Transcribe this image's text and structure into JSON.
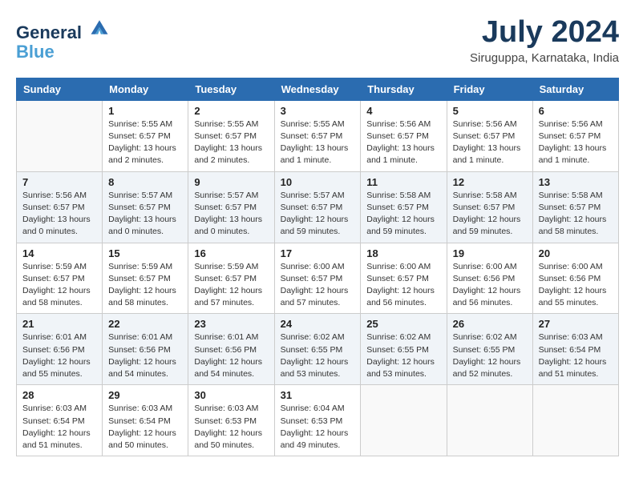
{
  "header": {
    "logo_line1": "General",
    "logo_line2": "Blue",
    "month": "July 2024",
    "location": "Siruguppa, Karnataka, India"
  },
  "weekdays": [
    "Sunday",
    "Monday",
    "Tuesday",
    "Wednesday",
    "Thursday",
    "Friday",
    "Saturday"
  ],
  "weeks": [
    [
      {
        "day": "",
        "sunrise": "",
        "sunset": "",
        "daylight": ""
      },
      {
        "day": "1",
        "sunrise": "Sunrise: 5:55 AM",
        "sunset": "Sunset: 6:57 PM",
        "daylight": "Daylight: 13 hours and 2 minutes."
      },
      {
        "day": "2",
        "sunrise": "Sunrise: 5:55 AM",
        "sunset": "Sunset: 6:57 PM",
        "daylight": "Daylight: 13 hours and 2 minutes."
      },
      {
        "day": "3",
        "sunrise": "Sunrise: 5:55 AM",
        "sunset": "Sunset: 6:57 PM",
        "daylight": "Daylight: 13 hours and 1 minute."
      },
      {
        "day": "4",
        "sunrise": "Sunrise: 5:56 AM",
        "sunset": "Sunset: 6:57 PM",
        "daylight": "Daylight: 13 hours and 1 minute."
      },
      {
        "day": "5",
        "sunrise": "Sunrise: 5:56 AM",
        "sunset": "Sunset: 6:57 PM",
        "daylight": "Daylight: 13 hours and 1 minute."
      },
      {
        "day": "6",
        "sunrise": "Sunrise: 5:56 AM",
        "sunset": "Sunset: 6:57 PM",
        "daylight": "Daylight: 13 hours and 1 minute."
      }
    ],
    [
      {
        "day": "7",
        "sunrise": "Sunrise: 5:56 AM",
        "sunset": "Sunset: 6:57 PM",
        "daylight": "Daylight: 13 hours and 0 minutes."
      },
      {
        "day": "8",
        "sunrise": "Sunrise: 5:57 AM",
        "sunset": "Sunset: 6:57 PM",
        "daylight": "Daylight: 13 hours and 0 minutes."
      },
      {
        "day": "9",
        "sunrise": "Sunrise: 5:57 AM",
        "sunset": "Sunset: 6:57 PM",
        "daylight": "Daylight: 13 hours and 0 minutes."
      },
      {
        "day": "10",
        "sunrise": "Sunrise: 5:57 AM",
        "sunset": "Sunset: 6:57 PM",
        "daylight": "Daylight: 12 hours and 59 minutes."
      },
      {
        "day": "11",
        "sunrise": "Sunrise: 5:58 AM",
        "sunset": "Sunset: 6:57 PM",
        "daylight": "Daylight: 12 hours and 59 minutes."
      },
      {
        "day": "12",
        "sunrise": "Sunrise: 5:58 AM",
        "sunset": "Sunset: 6:57 PM",
        "daylight": "Daylight: 12 hours and 59 minutes."
      },
      {
        "day": "13",
        "sunrise": "Sunrise: 5:58 AM",
        "sunset": "Sunset: 6:57 PM",
        "daylight": "Daylight: 12 hours and 58 minutes."
      }
    ],
    [
      {
        "day": "14",
        "sunrise": "Sunrise: 5:59 AM",
        "sunset": "Sunset: 6:57 PM",
        "daylight": "Daylight: 12 hours and 58 minutes."
      },
      {
        "day": "15",
        "sunrise": "Sunrise: 5:59 AM",
        "sunset": "Sunset: 6:57 PM",
        "daylight": "Daylight: 12 hours and 58 minutes."
      },
      {
        "day": "16",
        "sunrise": "Sunrise: 5:59 AM",
        "sunset": "Sunset: 6:57 PM",
        "daylight": "Daylight: 12 hours and 57 minutes."
      },
      {
        "day": "17",
        "sunrise": "Sunrise: 6:00 AM",
        "sunset": "Sunset: 6:57 PM",
        "daylight": "Daylight: 12 hours and 57 minutes."
      },
      {
        "day": "18",
        "sunrise": "Sunrise: 6:00 AM",
        "sunset": "Sunset: 6:57 PM",
        "daylight": "Daylight: 12 hours and 56 minutes."
      },
      {
        "day": "19",
        "sunrise": "Sunrise: 6:00 AM",
        "sunset": "Sunset: 6:56 PM",
        "daylight": "Daylight: 12 hours and 56 minutes."
      },
      {
        "day": "20",
        "sunrise": "Sunrise: 6:00 AM",
        "sunset": "Sunset: 6:56 PM",
        "daylight": "Daylight: 12 hours and 55 minutes."
      }
    ],
    [
      {
        "day": "21",
        "sunrise": "Sunrise: 6:01 AM",
        "sunset": "Sunset: 6:56 PM",
        "daylight": "Daylight: 12 hours and 55 minutes."
      },
      {
        "day": "22",
        "sunrise": "Sunrise: 6:01 AM",
        "sunset": "Sunset: 6:56 PM",
        "daylight": "Daylight: 12 hours and 54 minutes."
      },
      {
        "day": "23",
        "sunrise": "Sunrise: 6:01 AM",
        "sunset": "Sunset: 6:56 PM",
        "daylight": "Daylight: 12 hours and 54 minutes."
      },
      {
        "day": "24",
        "sunrise": "Sunrise: 6:02 AM",
        "sunset": "Sunset: 6:55 PM",
        "daylight": "Daylight: 12 hours and 53 minutes."
      },
      {
        "day": "25",
        "sunrise": "Sunrise: 6:02 AM",
        "sunset": "Sunset: 6:55 PM",
        "daylight": "Daylight: 12 hours and 53 minutes."
      },
      {
        "day": "26",
        "sunrise": "Sunrise: 6:02 AM",
        "sunset": "Sunset: 6:55 PM",
        "daylight": "Daylight: 12 hours and 52 minutes."
      },
      {
        "day": "27",
        "sunrise": "Sunrise: 6:03 AM",
        "sunset": "Sunset: 6:54 PM",
        "daylight": "Daylight: 12 hours and 51 minutes."
      }
    ],
    [
      {
        "day": "28",
        "sunrise": "Sunrise: 6:03 AM",
        "sunset": "Sunset: 6:54 PM",
        "daylight": "Daylight: 12 hours and 51 minutes."
      },
      {
        "day": "29",
        "sunrise": "Sunrise: 6:03 AM",
        "sunset": "Sunset: 6:54 PM",
        "daylight": "Daylight: 12 hours and 50 minutes."
      },
      {
        "day": "30",
        "sunrise": "Sunrise: 6:03 AM",
        "sunset": "Sunset: 6:53 PM",
        "daylight": "Daylight: 12 hours and 50 minutes."
      },
      {
        "day": "31",
        "sunrise": "Sunrise: 6:04 AM",
        "sunset": "Sunset: 6:53 PM",
        "daylight": "Daylight: 12 hours and 49 minutes."
      },
      {
        "day": "",
        "sunrise": "",
        "sunset": "",
        "daylight": ""
      },
      {
        "day": "",
        "sunrise": "",
        "sunset": "",
        "daylight": ""
      },
      {
        "day": "",
        "sunrise": "",
        "sunset": "",
        "daylight": ""
      }
    ]
  ]
}
